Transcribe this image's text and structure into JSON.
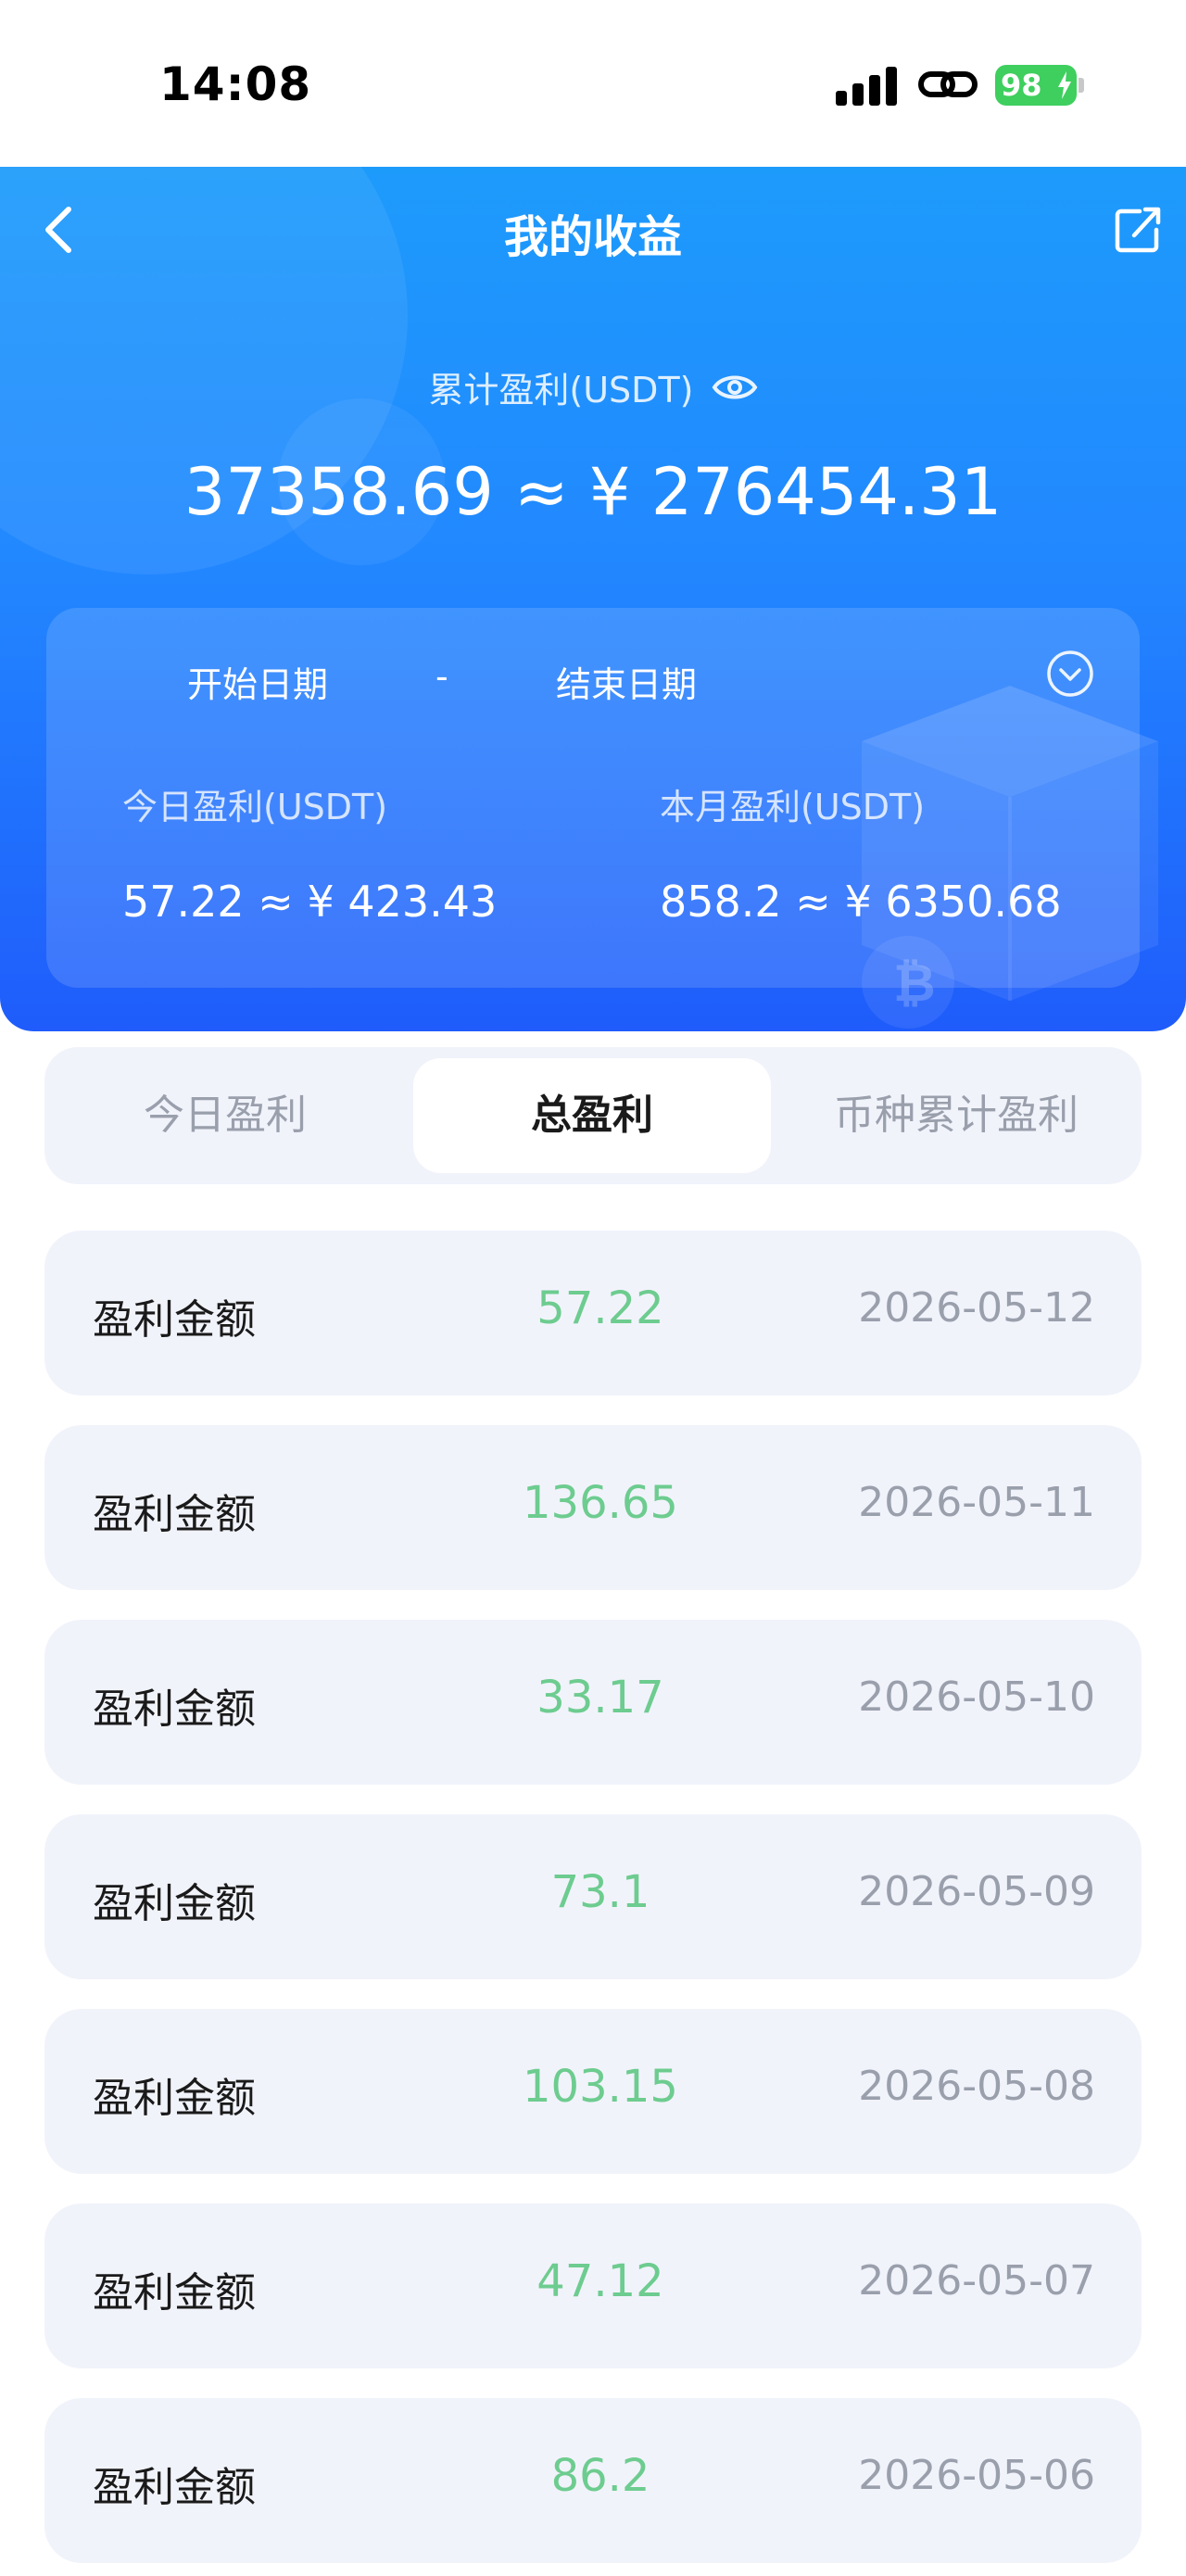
{
  "status_bar": {
    "time": "14:08",
    "battery": "98",
    "battery_color": "#3ecf5e"
  },
  "header": {
    "title": "我的收益",
    "back_icon": "chevron-left-icon",
    "share_icon": "share-icon",
    "total_label": "累计盈利(USDT)",
    "total_value": "37358.69 ≈ ¥ 276454.31",
    "date_start": "开始日期",
    "date_separator": "-",
    "date_end": "结束日期",
    "today_label": "今日盈利(USDT)",
    "today_value": "57.22 ≈ ¥ 423.43",
    "month_label": "本月盈利(USDT)",
    "month_value": "858.2 ≈ ¥ 6350.68",
    "gradient_top": "#1d9bfb",
    "gradient_bottom": "#1f5cfb"
  },
  "tabs": [
    {
      "label": "今日盈利",
      "active": false
    },
    {
      "label": "总盈利",
      "active": true
    },
    {
      "label": "币种累计盈利",
      "active": false
    }
  ],
  "records": [
    {
      "label": "盈利金额",
      "amount": "57.22",
      "date": "2026-05-12"
    },
    {
      "label": "盈利金额",
      "amount": "136.65",
      "date": "2026-05-11"
    },
    {
      "label": "盈利金额",
      "amount": "33.17",
      "date": "2026-05-10"
    },
    {
      "label": "盈利金额",
      "amount": "73.1",
      "date": "2026-05-09"
    },
    {
      "label": "盈利金额",
      "amount": "103.15",
      "date": "2026-05-08"
    },
    {
      "label": "盈利金额",
      "amount": "47.12",
      "date": "2026-05-07"
    },
    {
      "label": "盈利金额",
      "amount": "86.2",
      "date": "2026-05-06"
    }
  ],
  "colors": {
    "amount_green": "#6dcc8f",
    "row_bg": "#f1f3fb",
    "muted_text": "#9a9fac"
  }
}
